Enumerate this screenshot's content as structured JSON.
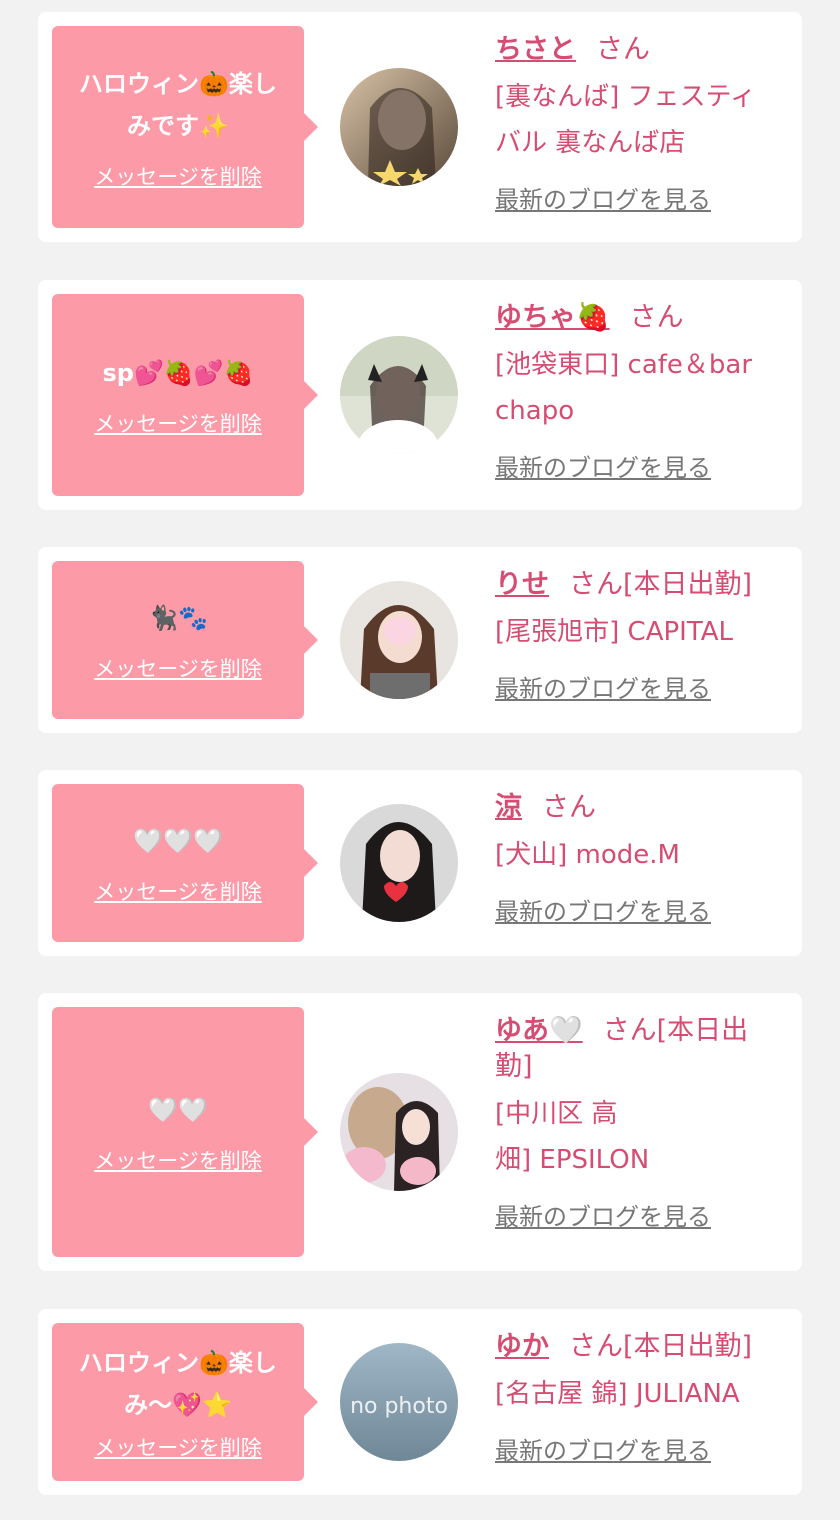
{
  "delete_label": "メッセージを削除",
  "blog_label": "最新のブログを見る",
  "san_label": "さん",
  "colors": {
    "page_bg": "#f2f2f2",
    "card_bg": "#ffffff",
    "bubble_bg": "#fd9aa8",
    "accent": "#d64d73",
    "link_gray": "#777777"
  },
  "entries": [
    {
      "message_lines": [
        "ハロウィン🎃楽し",
        "みです✨"
      ],
      "name": "ちさと",
      "status": "",
      "shop_lines": [
        "[裏なんば] フェスティ",
        "バル 裏なんば店"
      ],
      "avatar_icon": "avatar-photo"
    },
    {
      "message_lines": [
        "sp💕🍓💕🍓"
      ],
      "name": "ゆちゃ🍓",
      "status": "",
      "shop_lines": [
        "[池袋東口] cafe＆bar",
        "chapo"
      ],
      "avatar_icon": "avatar-photo"
    },
    {
      "message_lines": [
        "🐈‍⬛🐾"
      ],
      "name": "りせ",
      "status": "[本日出勤]",
      "shop_lines": [
        "[尾張旭市] CAPITAL"
      ],
      "avatar_icon": "avatar-photo"
    },
    {
      "message_lines": [
        "🤍🤍🤍"
      ],
      "name": "涼",
      "status": "",
      "shop_lines": [
        "[犬山] mode.M"
      ],
      "avatar_icon": "avatar-photo"
    },
    {
      "message_lines": [
        "🤍🤍"
      ],
      "name": "ゆあ🤍",
      "status": "[本日出勤]",
      "shop_lines": [
        "[中川区 高",
        "畑] EPSILON"
      ],
      "avatar_icon": "avatar-photo"
    },
    {
      "message_lines": [
        "ハロウィン🎃楽し",
        "み〜💖⭐"
      ],
      "name": "ゆか",
      "status": "[本日出勤]",
      "shop_lines": [
        "[名古屋 錦] JULIANA"
      ],
      "avatar_icon": "no-photo-placeholder",
      "avatar_text": "no photo"
    }
  ]
}
